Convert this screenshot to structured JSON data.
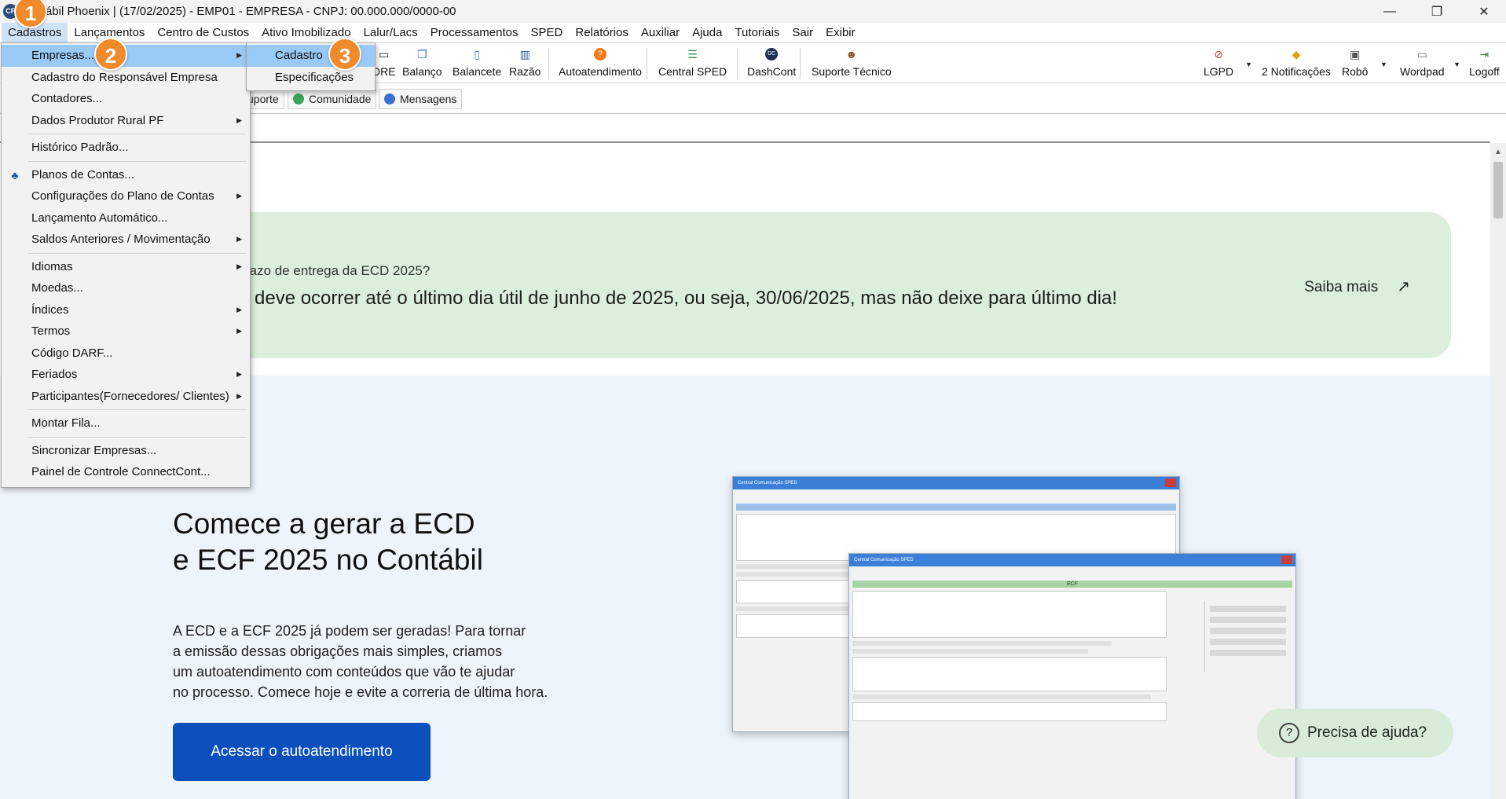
{
  "window": {
    "title": "ábil Phoenix | (17/02/2025) - EMP01 - EMPRESA  - CNPJ: 00.000.000/0000-00",
    "logo_text": "CP",
    "minimize": "—",
    "restore": "❐",
    "close": "✕"
  },
  "menubar": [
    "Cadastros",
    "Lançamentos",
    "Centro de Custos",
    "Ativo Imobilizado",
    "Lalur/Lacs",
    "Processamentos",
    "SPED",
    "Relatórios",
    "Auxiliar",
    "Ajuda",
    "Tutoriais",
    "Sair",
    "Exibir"
  ],
  "toolbar": {
    "dre": "DRE",
    "balanco": "Balanço",
    "balancete": "Balancete",
    "razao": "Razão",
    "autoatendimento": "Autoatendimento",
    "central_sped": "Central SPED",
    "dashcont": "DashCont",
    "suporte_tecnico": "Suporte Técnico",
    "lgpd": "LGPD",
    "notificacoes": "2 Notificações",
    "robo": "Robô",
    "wordpad": "Wordpad",
    "logoff": "Logoff"
  },
  "tabs": {
    "suporte": "uporte",
    "comunidade": "Comunidade",
    "mensagens": "Mensagens"
  },
  "banner": {
    "question": "razo de entrega da ECD 2025?",
    "answer": "deve ocorrer até o último dia útil de junho de 2025, ou seja, 30/06/2025, mas não deixe para último dia!",
    "link": "Saiba mais"
  },
  "hero": {
    "title_line1": "Comece a gerar a ECD",
    "title_line2": "e ECF 2025 no Contábil",
    "text_line1": "A ECD e a ECF 2025 já podem ser geradas! Para tornar",
    "text_line2": "a emissão dessas obrigações mais simples, criamos",
    "text_line3": "um autoatendimento com conteúdos que vão te ajudar",
    "text_line4": "no processo. Comece hoje e evite a correria de última hora.",
    "button": "Acessar o autoatendimento"
  },
  "help": {
    "label": "Precisa de ajuda?"
  },
  "mock": {
    "window_title": "Central Comunicação SPED",
    "section": "ECF"
  },
  "cadastros_menu": [
    {
      "label": "Empresas...",
      "submenu": true,
      "selected": true
    },
    {
      "label": "Cadastro do Responsável Empresa"
    },
    {
      "label": "Contadores..."
    },
    {
      "label": "Dados Produtor Rural PF",
      "submenu": true
    },
    {
      "label": "Histórico Padrão..."
    },
    {
      "label": "Planos de Contas..."
    },
    {
      "label": "Configurações do Plano de Contas",
      "submenu": true
    },
    {
      "label": "Lançamento Automático..."
    },
    {
      "label": "Saldos Anteriores / Movimentação",
      "submenu": true
    },
    {
      "label": "Idiomas",
      "submenu": true
    },
    {
      "label": "Moedas..."
    },
    {
      "label": "Índices",
      "submenu": true
    },
    {
      "label": "Termos",
      "submenu": true
    },
    {
      "label": "Código DARF..."
    },
    {
      "label": "Feriados",
      "submenu": true
    },
    {
      "label": "Participantes(Fornecedores/ Clientes)",
      "submenu": true
    },
    {
      "label": "Montar Fila..."
    },
    {
      "label": "Sincronizar Empresas..."
    },
    {
      "label": "Painel de Controle ConnectCont..."
    }
  ],
  "empresas_submenu": [
    {
      "label": "Cadastro",
      "selected": true
    },
    {
      "label": "Especificações"
    }
  ],
  "markers": [
    "1",
    "2",
    "3"
  ],
  "colors": {
    "menu_selection": "#99c9f5",
    "banner_bg": "#dcefdc",
    "primary_button": "#0b4fbd",
    "marker": "#f08a2b"
  }
}
